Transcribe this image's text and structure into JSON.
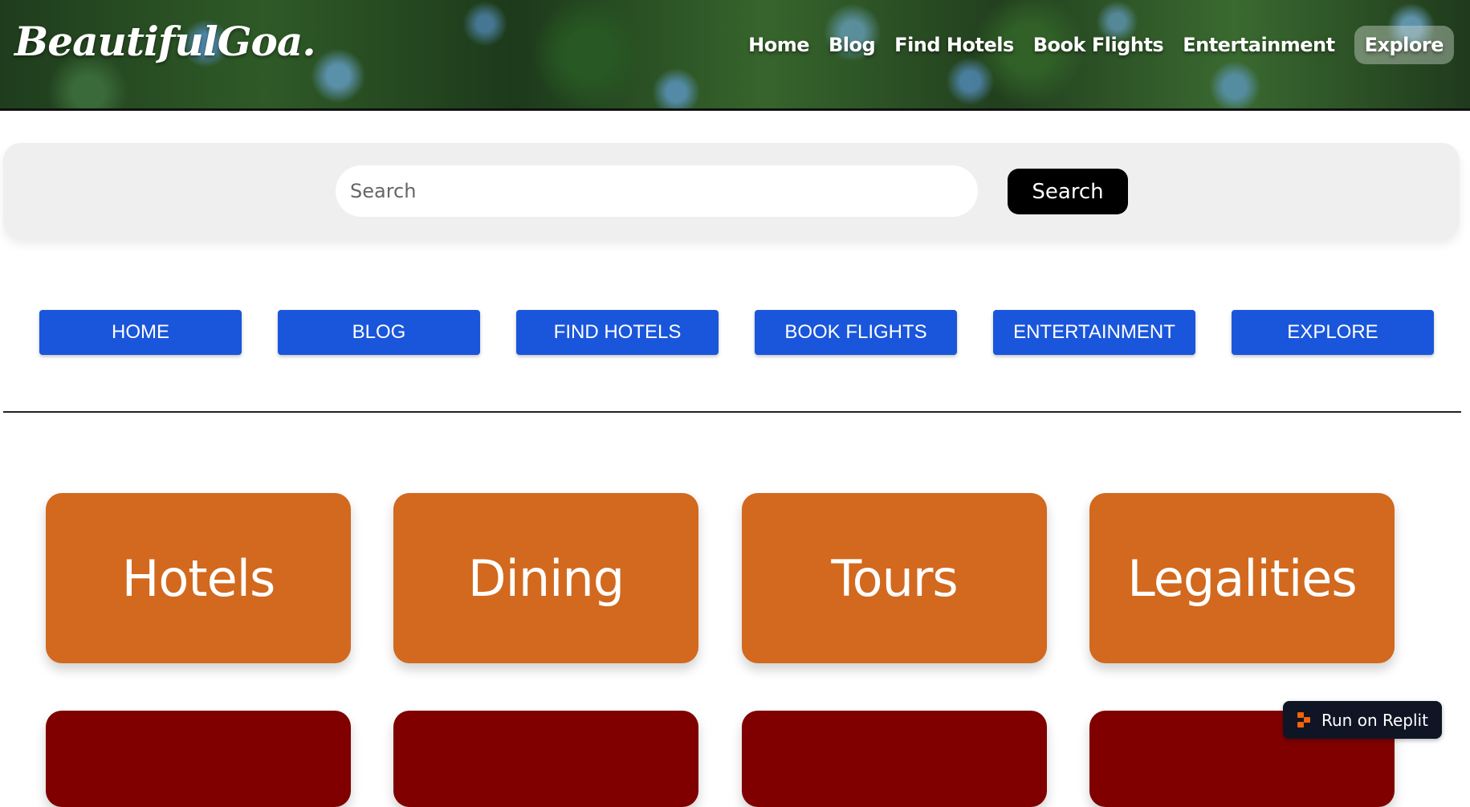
{
  "header": {
    "logo": "BeautifulGoa.",
    "nav": [
      "Home",
      "Blog",
      "Find Hotels",
      "Book Flights",
      "Entertainment",
      "Explore"
    ]
  },
  "search": {
    "placeholder": "Search",
    "button_label": "Search"
  },
  "blue_nav": [
    "HOME",
    "BLOG",
    "FIND HOTELS",
    "BOOK FLIGHTS",
    "ENTERTAINMENT",
    "EXPLORE"
  ],
  "cards": [
    "Hotels",
    "Dining",
    "Tours",
    "Legalities"
  ],
  "colors": {
    "blue_button": "#1a56db",
    "card_orange": "#d2691e",
    "card_dark_red": "#800000",
    "search_button": "#000000"
  },
  "replit_badge": {
    "label": "Run on Replit",
    "icon": "replit-icon"
  }
}
